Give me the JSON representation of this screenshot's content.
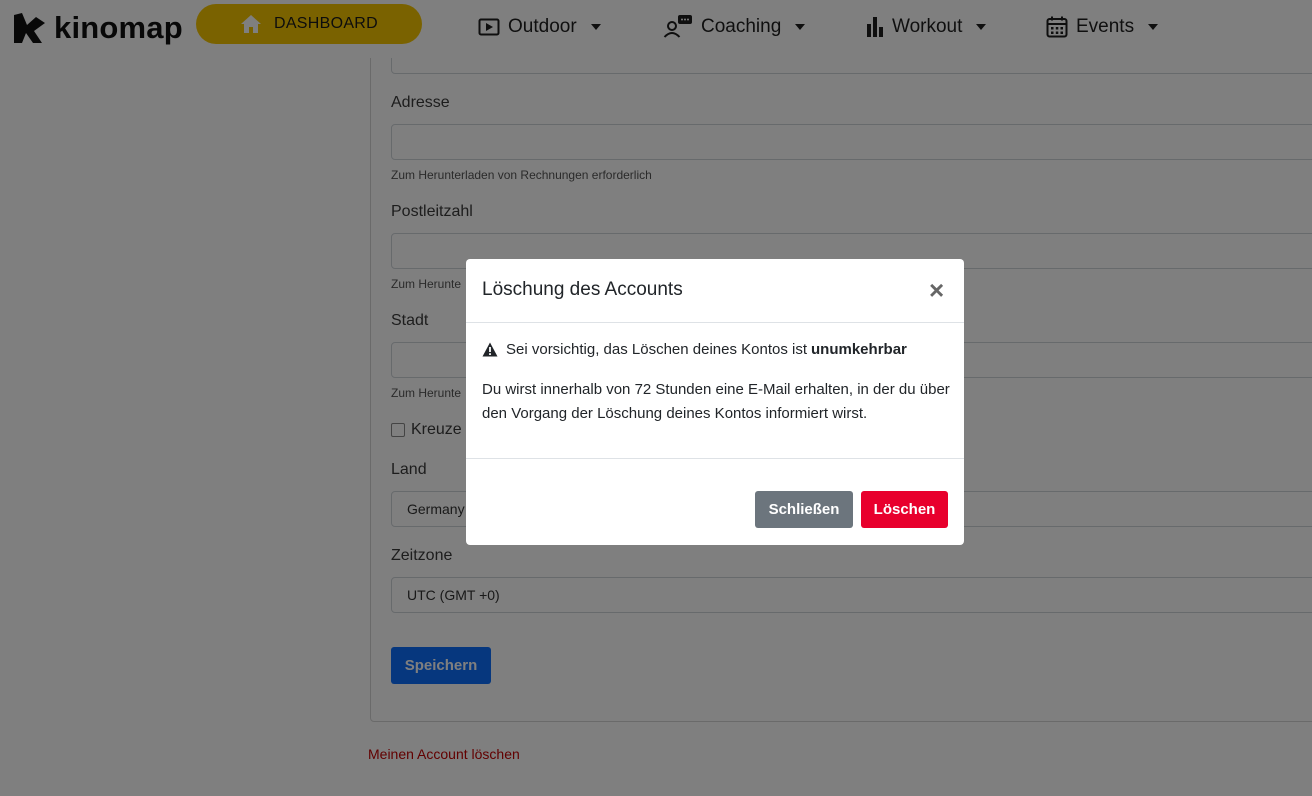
{
  "navbar": {
    "logo_text": "kinomap",
    "dashboard_label": "DASHBOARD",
    "items": [
      {
        "label": "Outdoor",
        "icon": "play-square-icon"
      },
      {
        "label": "Coaching",
        "icon": "coach-chat-icon"
      },
      {
        "label": "Workout",
        "icon": "bar-chart-icon"
      },
      {
        "label": "Events",
        "icon": "calendar-icon"
      }
    ]
  },
  "form": {
    "address_label": "Adresse",
    "address_help": "Zum Herunterladen von Rechnungen erforderlich",
    "zip_label": "Postleitzahl",
    "zip_help": "Zum Herunte",
    "city_label": "Stadt",
    "city_help": "Zum Herunte",
    "checkbox_label": "Kreuze d",
    "country_label": "Land",
    "country_value": "Germany",
    "timezone_label": "Zeitzone",
    "timezone_value": "UTC (GMT +0)",
    "save_label": "Speichern",
    "delete_account_link": "Meinen Account löschen"
  },
  "modal": {
    "title": "Löschung des Accounts",
    "close_symbol": "×",
    "warning_text": "Sei vorsichtig, das Löschen deines Kontos ist",
    "warning_strong": "unumkehrbar",
    "body_text": "Du wirst innerhalb von 72 Stunden eine E-Mail erhalten, in der du über den Vorgang der Löschung deines Kontos informiert wirst.",
    "close_button": "Schließen",
    "delete_button": "Löschen"
  },
  "colors": {
    "dashboard_yellow": "#f5c500",
    "save_blue": "#0d6efd",
    "delete_red": "#e8002d",
    "secondary_gray": "#6c757d",
    "link_red": "#c40000"
  }
}
